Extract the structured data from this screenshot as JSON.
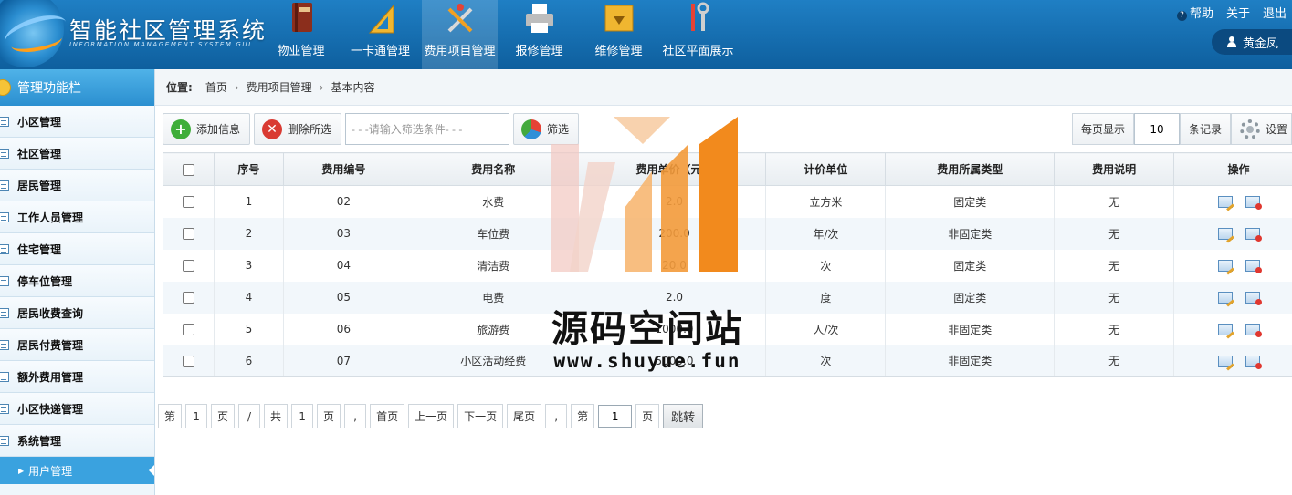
{
  "header": {
    "title": "智能社区管理系统",
    "subtitle": "INFORMATION MANAGEMENT SYSTEM GUI",
    "nav": [
      {
        "label": "物业管理",
        "icon": "book-icon",
        "active": false
      },
      {
        "label": "一卡通管理",
        "icon": "ruler-icon",
        "active": false
      },
      {
        "label": "费用项目管理",
        "icon": "tools-icon",
        "active": true
      },
      {
        "label": "报修管理",
        "icon": "printer-icon",
        "active": false
      },
      {
        "label": "维修管理",
        "icon": "folder-icon",
        "active": false
      },
      {
        "label": "社区平面展示",
        "icon": "wrench-icon",
        "active": false
      }
    ],
    "links": {
      "help": "帮助",
      "about": "关于",
      "logout": "退出"
    },
    "user": "黄金凤"
  },
  "sidebar": {
    "title": "管理功能栏",
    "items": [
      {
        "label": "小区管理"
      },
      {
        "label": "社区管理"
      },
      {
        "label": "居民管理"
      },
      {
        "label": "工作人员管理"
      },
      {
        "label": "住宅管理"
      },
      {
        "label": "停车位管理"
      },
      {
        "label": "居民收费查询"
      },
      {
        "label": "居民付费管理"
      },
      {
        "label": "额外费用管理"
      },
      {
        "label": "小区快递管理"
      },
      {
        "label": "系统管理"
      }
    ],
    "sub_item": "用户管理"
  },
  "breadcrumb": {
    "label": "位置:",
    "items": [
      "首页",
      "费用项目管理",
      "基本内容"
    ]
  },
  "toolbar": {
    "add_label": "添加信息",
    "delete_label": "删除所选",
    "search_placeholder": "- - -请输入筛选条件- - -",
    "filter_label": "筛选",
    "per_page_label": "每页显示",
    "per_page_value": "10",
    "records_label": "条记录",
    "settings_label": "设置"
  },
  "table": {
    "columns": [
      "序号",
      "费用编号",
      "费用名称",
      "费用单价（元）",
      "计价单位",
      "费用所属类型",
      "费用说明",
      "操作"
    ],
    "rows": [
      {
        "no": "1",
        "code": "02",
        "name": "水费",
        "price": "2.0",
        "unit": "立方米",
        "type": "固定类",
        "desc": "无"
      },
      {
        "no": "2",
        "code": "03",
        "name": "车位费",
        "price": "200.0",
        "unit": "年/次",
        "type": "非固定类",
        "desc": "无"
      },
      {
        "no": "3",
        "code": "04",
        "name": "清洁费",
        "price": "20.0",
        "unit": "次",
        "type": "固定类",
        "desc": "无"
      },
      {
        "no": "4",
        "code": "05",
        "name": "电费",
        "price": "2.0",
        "unit": "度",
        "type": "固定类",
        "desc": "无"
      },
      {
        "no": "5",
        "code": "06",
        "name": "旅游费",
        "price": "1000.0",
        "unit": "人/次",
        "type": "非固定类",
        "desc": "无"
      },
      {
        "no": "6",
        "code": "07",
        "name": "小区活动经费",
        "price": "5000.0",
        "unit": "次",
        "type": "非固定类",
        "desc": "无"
      }
    ]
  },
  "pager": {
    "di": "第",
    "page_current": "1",
    "ye": "页",
    "slash": "/",
    "gong": "共",
    "page_total": "1",
    "ye2": "页",
    "comma": ",",
    "first": "首页",
    "prev": "上一页",
    "next": "下一页",
    "last": "尾页",
    "comma2": ",",
    "di2": "第",
    "jump_value": "1",
    "ye3": "页",
    "go": "跳转"
  },
  "watermark": {
    "text": "源码空间站",
    "url": "www.shuyue.fun"
  }
}
